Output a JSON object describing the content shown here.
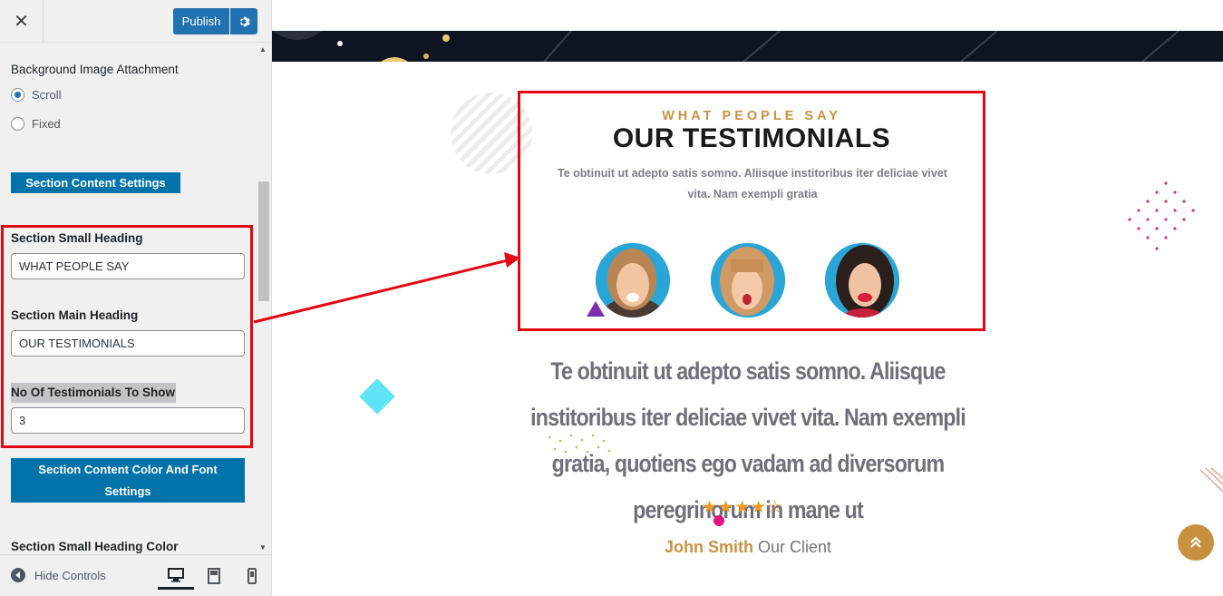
{
  "topbar": {
    "close_icon": "close-icon",
    "publish_label": "Publish",
    "settings_icon": "gear-icon"
  },
  "panel": {
    "bg_attachment_title": "Background Image Attachment",
    "radio_options": [
      {
        "label": "Scroll",
        "checked": true
      },
      {
        "label": "Fixed",
        "checked": false
      }
    ],
    "section_content_settings": "Section Content Settings",
    "small_heading_label": "Section Small Heading",
    "small_heading_value": "WHAT PEOPLE SAY",
    "main_heading_label": "Section Main Heading",
    "main_heading_value": "OUR TESTIMONIALS",
    "num_testimonials_label": "No Of Testimonials To Show",
    "num_testimonials_value": "3",
    "color_font_settings": "Section Content Color And Font Settings",
    "small_heading_color_label": "Section Small Heading Color"
  },
  "bottombar": {
    "hide_controls": "Hide Controls",
    "devices": [
      "desktop-icon",
      "tablet-icon",
      "mobile-icon"
    ]
  },
  "preview": {
    "small_heading": "WHAT PEOPLE SAY",
    "main_heading": "OUR TESTIMONIALS",
    "sub_text": "Te obtinuit ut adepto satis somno. Aliisque institoribus iter deliciae vivet vita. Nam exempli gratia",
    "quote": "Te obtinuit ut adepto satis somno. Aliisque institoribus iter deliciae vivet vita. Nam exempli gratia, quotiens ego vadam ad diversorum peregrinorum in mane ut",
    "rating": {
      "filled": 4,
      "total": 5
    },
    "client_name": "John Smith",
    "client_role": "Our Client"
  },
  "colors": {
    "accent_gold": "#c8913f",
    "wp_blue": "#2271b1",
    "annotation_red": "#e30613"
  }
}
